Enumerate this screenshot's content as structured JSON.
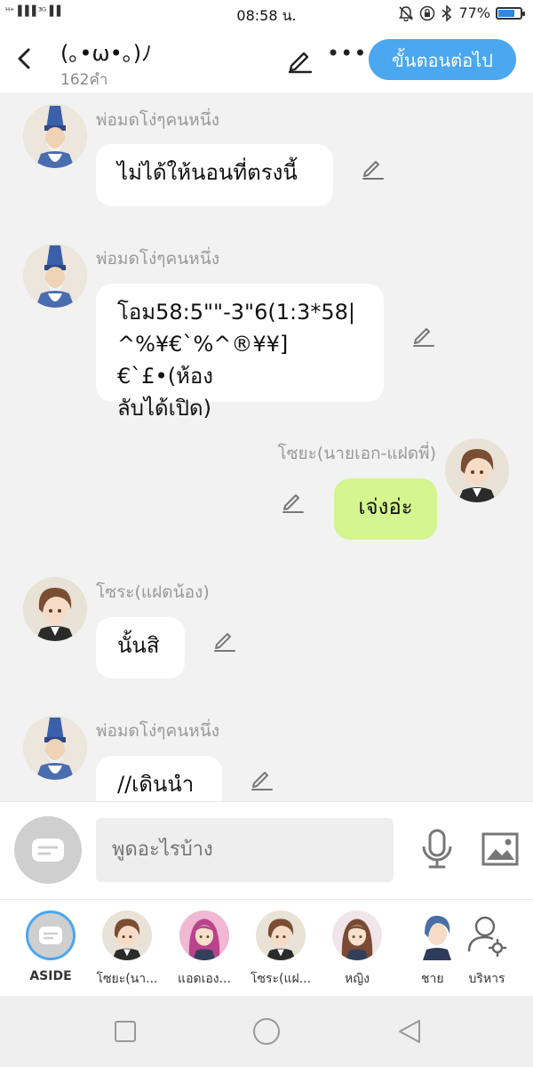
{
  "status_bar": {
    "signal": "ᴴ⁺▐▐▐ ³ᴳ▐▐",
    "time": "08:58 น.",
    "battery": "77%",
    "battery_level": 0.77
  },
  "header": {
    "title": "(｡•ω•｡)ﾉ",
    "subtitle": "162คำ",
    "next_label": "ขั้นตอนต่อไป",
    "more_label": "•••"
  },
  "messages": [
    {
      "sender": "พ่อมดโง่ๆคนหนึ่ง",
      "text": "ไม่ได้ให้นอนที่ตรงนี้",
      "self": false,
      "avatar": "old-wizard-avatar"
    },
    {
      "sender": "พ่อมดโง่ๆคนหนึ่ง",
      "text": "โอม58:5\"\"-3\"6(1:3*58|^%¥€`%^®¥¥]€`£•(ห้องลับได้เปิด)",
      "lines": [
        "โอม58:5\"\"-3\"6(1:3*58|",
        "^%¥€`%^®¥¥]€`£•(ห้อง",
        "ลับได้เปิด)"
      ],
      "self": false,
      "avatar": "old-wizard-avatar"
    },
    {
      "sender": "โซยะ(นายเอก-แฝดพี่)",
      "text": "เจ่งอ่ะ",
      "self": true,
      "avatar": "brown-hair-boy-avatar"
    },
    {
      "sender": "โซระ(แฝดน้อง)",
      "text": "นั้นสิ",
      "self": false,
      "avatar": "brown-hair-boy-avatar"
    },
    {
      "sender": "พ่อมดโง่ๆคนหนึ่ง",
      "text": "//เดินนำ",
      "self": false,
      "avatar": "old-wizard-avatar"
    }
  ],
  "input": {
    "placeholder": "พูดอะไรบ้าง"
  },
  "characters": [
    {
      "label": "ASIDE",
      "icon": "aside-icon",
      "selected": true
    },
    {
      "label": "โซยะ(นา...",
      "icon": "brown-hair-boy-avatar"
    },
    {
      "label": "แอดเอง...",
      "icon": "pink-hair-girl-avatar"
    },
    {
      "label": "โซระ(แฝ...",
      "icon": "brown-hair-boy-avatar"
    },
    {
      "label": "หญิง",
      "icon": "brown-hair-girl-avatar"
    },
    {
      "label": "ชาย",
      "icon": "blue-hair-boy-avatar"
    },
    {
      "label": "บริหาร",
      "icon": "manage-characters-icon"
    }
  ],
  "colors": {
    "accent": "#4aa7f0",
    "self_bubble": "#d4f58f",
    "other_bubble": "#ffffff",
    "background": "#f2f2f2"
  }
}
